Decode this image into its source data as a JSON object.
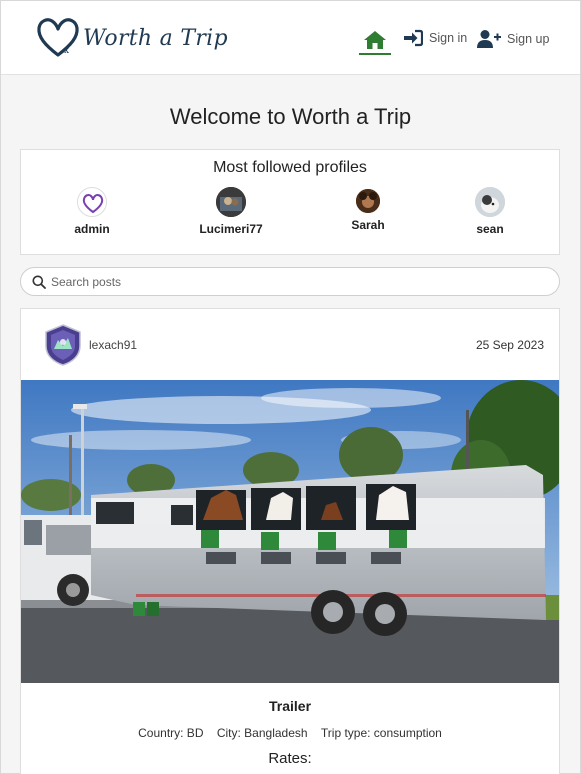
{
  "navbar": {
    "brand": "Worth a Trip",
    "nav": [
      {
        "label": "",
        "icon": "home-icon",
        "active": true
      },
      {
        "label": "Sign in",
        "icon": "sign-in-icon"
      },
      {
        "label": "Sign up",
        "icon": "user-plus-icon"
      }
    ]
  },
  "welcome": "Welcome to Worth a Trip",
  "followed": {
    "title": "Most followed profiles",
    "profiles": [
      {
        "name": "admin",
        "icon": "heart-logo-avatar"
      },
      {
        "name": "Lucimeri77",
        "icon": "photo-avatar"
      },
      {
        "name": "Sarah",
        "icon": "photo-avatar"
      },
      {
        "name": "sean",
        "icon": "dog-photo-avatar"
      }
    ]
  },
  "search": {
    "placeholder": "Search posts",
    "value": ""
  },
  "post": {
    "author": "lexach91",
    "date": "25 Sep 2023",
    "title": "Trailer",
    "country": "Country: BD",
    "city": "City: Bangladesh",
    "trip_type": "Trip type: consumption",
    "rates_label": "Rates:"
  },
  "colors": {
    "accent": "#2e7d32",
    "brand": "#1f3a52",
    "nav_icon": "#1f3a52"
  }
}
